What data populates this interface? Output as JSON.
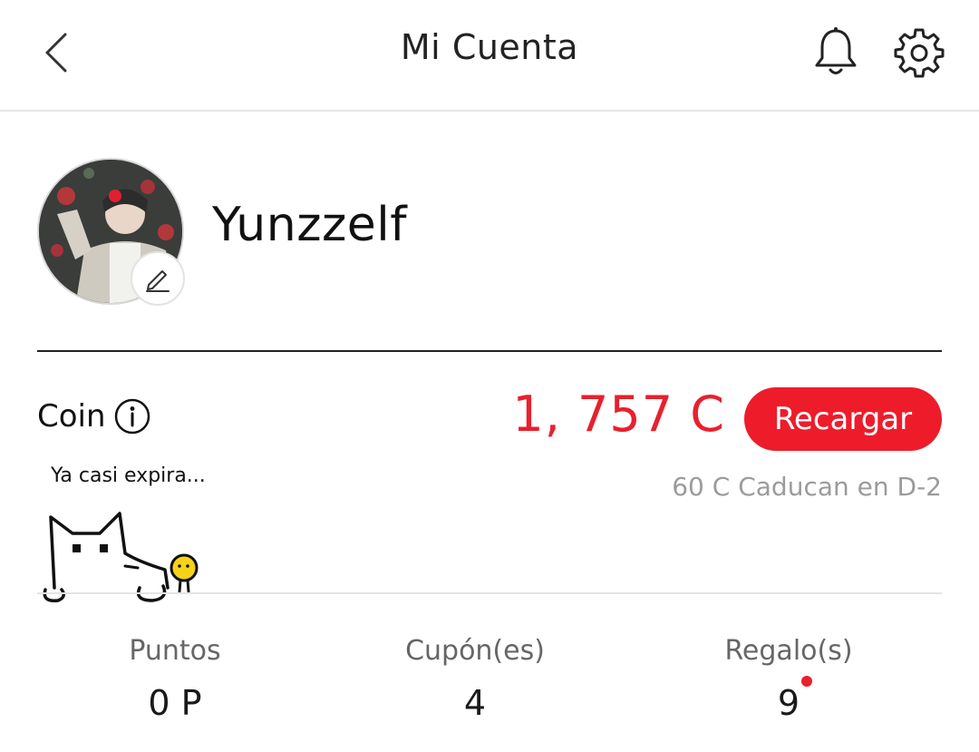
{
  "header": {
    "title": "Mi Cuenta",
    "back_icon": "chevron-left-icon",
    "notification_icon": "bell-icon",
    "settings_icon": "gear-icon"
  },
  "profile": {
    "username": "Yunzzelf",
    "edit_icon": "pencil-icon"
  },
  "coin": {
    "label": "Coin",
    "amount": "1, 757 C",
    "recharge_label": "Recargar",
    "expire_tag": "Ya casi expira...",
    "expire_note": "60 C Caducan en D-2"
  },
  "stats": [
    {
      "label": "Puntos",
      "value": "0 P",
      "has_dot": false
    },
    {
      "label": "Cupón(es)",
      "value": "4",
      "has_dot": false
    },
    {
      "label": "Regalo(s)",
      "value": "9",
      "has_dot": true
    }
  ],
  "colors": {
    "accent": "#ee1c2b",
    "coin_text": "#e8202d",
    "muted_text": "#9b9b9b"
  }
}
